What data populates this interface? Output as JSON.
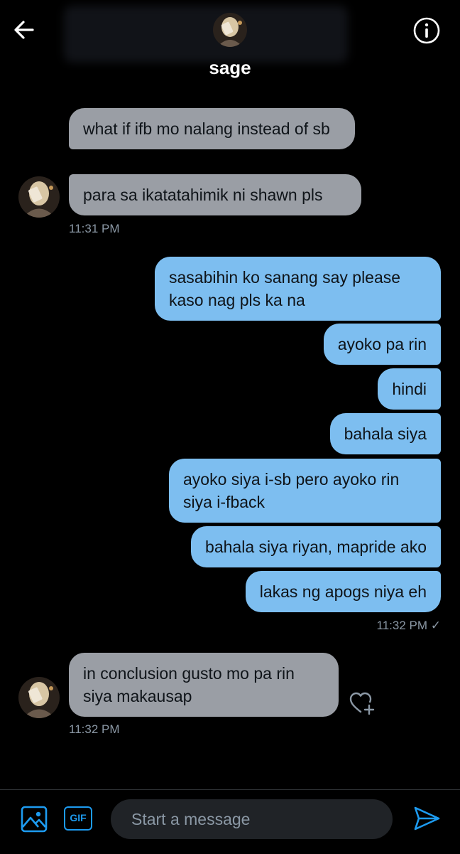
{
  "header": {
    "name": "sage"
  },
  "messages": {
    "in1": "what if ifb mo nalang instead of sb",
    "in2": "para sa ikatatahimik ni shawn pls",
    "time1": "11:31 PM",
    "out1": "sasabihin ko sanang say please kaso nag pls ka na",
    "out2": "ayoko pa rin",
    "out3": "hindi",
    "out4": "bahala siya",
    "out5": "ayoko siya i-sb pero ayoko rin siya i-fback",
    "out6": "bahala siya riyan, mapride ako",
    "out7": "lakas ng apogs niya eh",
    "time2": "11:32 PM ✓",
    "in3": "in conclusion gusto mo pa rin siya makausap",
    "time3": "11:32 PM"
  },
  "composer": {
    "gif_label": "GIF",
    "placeholder": "Start a message"
  },
  "colors": {
    "incoming_bubble": "#9a9ea5",
    "outgoing_bubble": "#7dbef0",
    "accent": "#1d9bf0",
    "background": "#000000"
  },
  "icons": [
    "back-arrow-icon",
    "info-icon",
    "heart-plus-icon",
    "image-icon",
    "gif-icon",
    "send-icon"
  ]
}
